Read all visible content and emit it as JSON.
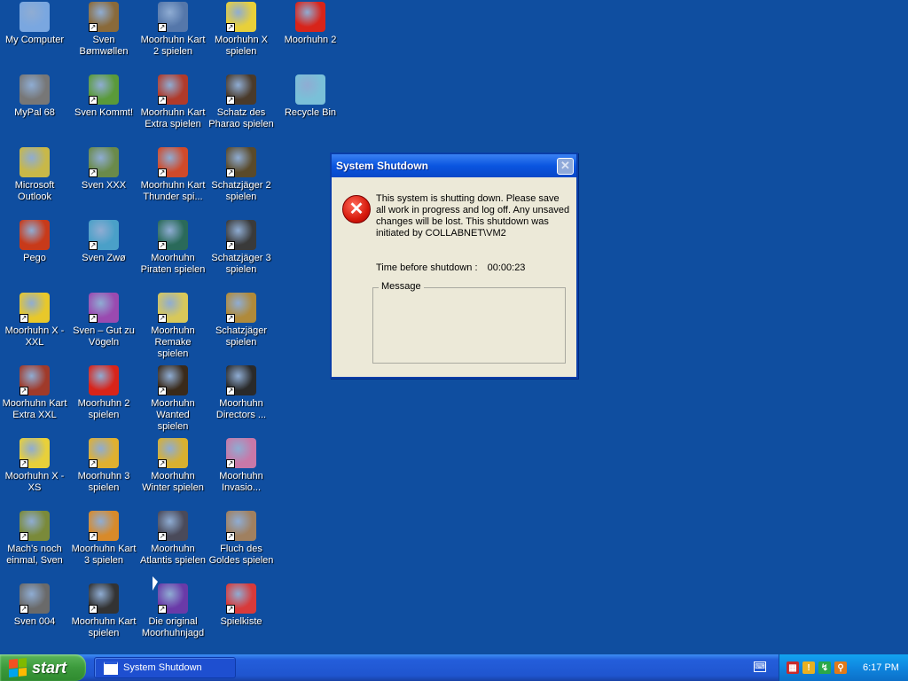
{
  "desktop_icons": [
    {
      "label": "My Computer",
      "icon": "computer-icon",
      "color": "#7aa7e0"
    },
    {
      "label": "Sven Bømwøllen",
      "icon": "sheep-icon",
      "color": "#8a6a3a"
    },
    {
      "label": "Moorhuhn Kart 2 spielen",
      "icon": "kart-icon",
      "color": "#5577aa"
    },
    {
      "label": "Moorhuhn X spielen",
      "icon": "chicken-icon",
      "color": "#e8d03a"
    },
    {
      "label": "Moorhuhn 2",
      "icon": "number-2-icon",
      "color": "#d8241a"
    },
    {
      "label": "MyPal 68",
      "icon": "raccoon-icon",
      "color": "#777777"
    },
    {
      "label": "Sven Kommt!",
      "icon": "sheep-icon",
      "color": "#5a9a3a"
    },
    {
      "label": "Moorhuhn Kart Extra spielen",
      "icon": "chicken-icon",
      "color": "#b03a2a"
    },
    {
      "label": "Schatz des Pharao spielen",
      "icon": "chicken-explorer-icon",
      "color": "#4a3a2a"
    },
    {
      "label": "Recycle Bin",
      "icon": "recycle-bin-icon",
      "color": "#7ac0d8"
    },
    {
      "label": "Microsoft Outlook",
      "icon": "outlook-icon",
      "color": "#c8b848"
    },
    {
      "label": "Sven XXX",
      "icon": "sheep-icon",
      "color": "#6a8a4a"
    },
    {
      "label": "Moorhuhn Kart Thunder spi...",
      "icon": "kart-icon",
      "color": "#d04a2a"
    },
    {
      "label": "Schatzjäger 2 spielen",
      "icon": "chicken-explorer-icon",
      "color": "#5a4a2a"
    },
    {
      "label": "Pego",
      "icon": "red-ball-icon",
      "color": "#c83a1a"
    },
    {
      "label": "Sven Zwø",
      "icon": "sheep-icon",
      "color": "#4aa0c8"
    },
    {
      "label": "Moorhuhn Piraten spielen",
      "icon": "pirate-icon",
      "color": "#2a6a5a"
    },
    {
      "label": "Schatzjäger 3 spielen",
      "icon": "chicken-explorer-icon",
      "color": "#3a3a3a"
    },
    {
      "label": "Moorhuhn X - XXL",
      "icon": "chicken-icon",
      "color": "#e8c82a"
    },
    {
      "label": "Sven – Gut zu Vögeln",
      "icon": "sheep-icon",
      "color": "#9a4ab0"
    },
    {
      "label": "Moorhuhn Remake spielen",
      "icon": "chicken-icon",
      "color": "#d8c85a"
    },
    {
      "label": "Schatzjäger spielen",
      "icon": "amulet-icon",
      "color": "#b08a3a"
    },
    {
      "label": "Moorhuhn Kart Extra XXL",
      "icon": "chicken-icon",
      "color": "#a03a2a"
    },
    {
      "label": "Moorhuhn 2 spielen",
      "icon": "number-2-icon",
      "color": "#d8241a"
    },
    {
      "label": "Moorhuhn Wanted spielen",
      "icon": "chicken-icon",
      "color": "#3a2a1a"
    },
    {
      "label": "Moorhuhn Directors ...",
      "icon": "clapperboard-icon",
      "color": "#2a2a2a"
    },
    {
      "label": "Moorhuhn X - XS",
      "icon": "chicken-icon",
      "color": "#e8d03a"
    },
    {
      "label": "Moorhuhn 3 spielen",
      "icon": "chicken-icon",
      "color": "#e0b030"
    },
    {
      "label": "Moorhuhn Winter spielen",
      "icon": "chicken-icon",
      "color": "#d8b030"
    },
    {
      "label": "Moorhuhn Invasio...",
      "icon": "chicken-icon",
      "color": "#c878a8"
    },
    {
      "label": "Mach's noch einmal, Sven",
      "icon": "sheep-icon",
      "color": "#7a8a3a"
    },
    {
      "label": "Moorhuhn Kart 3 spielen",
      "icon": "kart-icon",
      "color": "#d88a2a"
    },
    {
      "label": "Moorhuhn Atlantis spielen",
      "icon": "chicken-icon",
      "color": "#4a4a5a"
    },
    {
      "label": "Fluch des Goldes spielen",
      "icon": "gold-icon",
      "color": "#a08060"
    },
    {
      "label": "Sven 004",
      "icon": "sheep-icon",
      "color": "#6a6a6a"
    },
    {
      "label": "Moorhuhn Kart spielen",
      "icon": "checkered-flag-icon",
      "color": "#333333"
    },
    {
      "label": "Die original Moorhuhnjagd",
      "icon": "chicken-icon",
      "color": "#6a3aa8"
    },
    {
      "label": "Spielkiste",
      "icon": "games-box-icon",
      "color": "#d83a3a"
    }
  ],
  "dialog": {
    "title": "System Shutdown",
    "message": "This system is shutting down. Please save all work in progress and log off. Any unsaved changes will be lost. This shutdown was initiated by COLLABNET\\VM2",
    "countdown_label": "Time before shutdown :",
    "countdown_value": "00:00:23",
    "message_group_label": "Message",
    "close_glyph": "✕"
  },
  "taskbar": {
    "start_label": "start",
    "task_button_label": "System Shutdown",
    "clock": "6:17 PM"
  },
  "tray_icons": [
    "flag-icon",
    "shield-icon",
    "network-icon",
    "search-icon"
  ]
}
